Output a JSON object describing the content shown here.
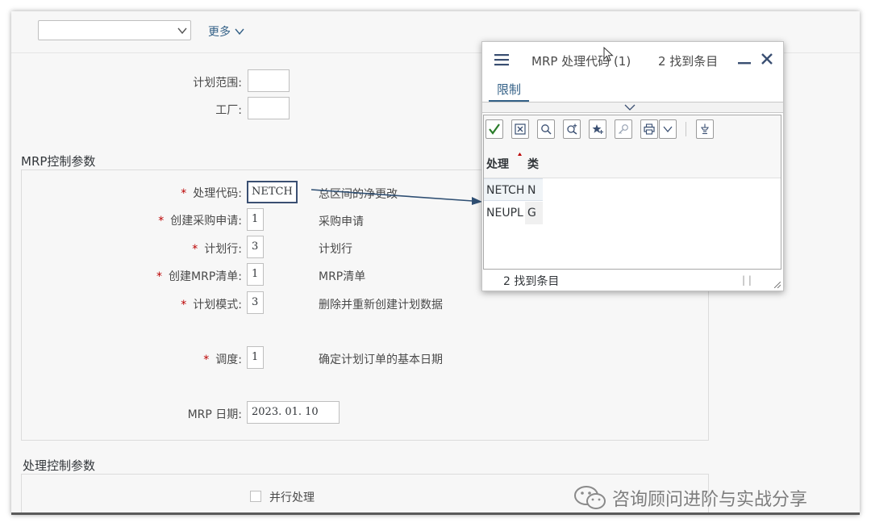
{
  "toolbar": {
    "variant_value": "",
    "more_label": "更多"
  },
  "planning": {
    "scope_label": "计划范围:",
    "scope_value": "",
    "plant_label": "工厂:",
    "plant_value": ""
  },
  "mrp_section": {
    "title": "MRP控制参数",
    "rows": [
      {
        "label": "处理代码:",
        "value": "NETCH",
        "desc": "总区间的净更改",
        "required": true
      },
      {
        "label": "创建采购申请:",
        "value": "1",
        "desc": "采购申请",
        "required": true
      },
      {
        "label": "计划行:",
        "value": "3",
        "desc": "计划行",
        "required": true
      },
      {
        "label": "创建MRP清单:",
        "value": "1",
        "desc": "MRP清单",
        "required": true
      },
      {
        "label": "计划模式:",
        "value": "3",
        "desc": "删除并重新创建计划数据",
        "required": true
      },
      {
        "label": "调度:",
        "value": "1",
        "desc": "确定计划订单的基本日期",
        "required": true
      }
    ],
    "required_mark": "*",
    "date_label": "MRP 日期:",
    "date_value": "2023. 01. 10"
  },
  "processing_section": {
    "title": "处理控制参数",
    "parallel_label": "并行处理"
  },
  "popup": {
    "title": "MRP 处理代码 (1)",
    "count": "2 找到条目",
    "restrict_tab": "限制",
    "columns": [
      "处理",
      "类"
    ],
    "rows": [
      [
        "NETCH",
        "N"
      ],
      [
        "NEUPL",
        "G"
      ]
    ],
    "footer": "2 找到条目",
    "footer_seps": "|      |"
  },
  "watermark": {
    "text": "咨询顾问进阶与实战分享"
  },
  "colors": {
    "accent": "#346187",
    "required": "#bb0000",
    "confirm_green": "#2b7d2b",
    "arrow": "#2f4f73"
  }
}
